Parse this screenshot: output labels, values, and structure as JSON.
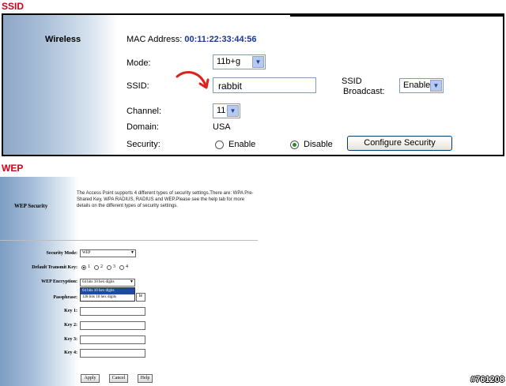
{
  "ssid_section": {
    "title": "SSID",
    "sidebar_label": "Wireless",
    "mac_label": "MAC Address:",
    "mac_value": "00:11:22:33:44:56",
    "mode_label": "Mode:",
    "mode_value": "11b+g",
    "ssid_label": "SSID:",
    "ssid_value": "rabbit",
    "broadcast_label_line1": "SSID",
    "broadcast_label_line2": "Broadcast:",
    "broadcast_value": "Enable",
    "channel_label": "Channel:",
    "channel_value": "11",
    "domain_label": "Domain:",
    "domain_value": "USA",
    "security_label": "Security:",
    "security_enable": "Enable",
    "security_disable": "Disable",
    "configure_button": "Configure Security",
    "annotation_color": "#e0201a"
  },
  "wep_section": {
    "title": "WEP",
    "sidebar_label": "WEP Security",
    "description": "The Access Point supports 4 different types of security settings.There are: WPA Pre-Shared Key, WPA RADIUS, RADIUS and WEP.Please see the help tab for more details on the different types of security settings.",
    "security_mode_label": "Security Mode:",
    "security_mode_value": "WEP",
    "transmit_key_label": "Default Transmit Key:",
    "transmit_keys": [
      "1",
      "2",
      "3",
      "4"
    ],
    "encryption_label": "WEP Encryption:",
    "encryption_value": "64 bits 10 hex digits",
    "encryption_options": [
      "64 bits 10 hex digits",
      "128 bits 10 hex digits"
    ],
    "passphrase_label": "Passphrase:",
    "generate_button": "te",
    "key_labels": [
      "Key 1:",
      "Key 2:",
      "Key 3:",
      "Key 4:"
    ],
    "apply_button": "Apply",
    "cancel_button": "Cancel",
    "help_button": "Help"
  },
  "watermark": "#761208"
}
